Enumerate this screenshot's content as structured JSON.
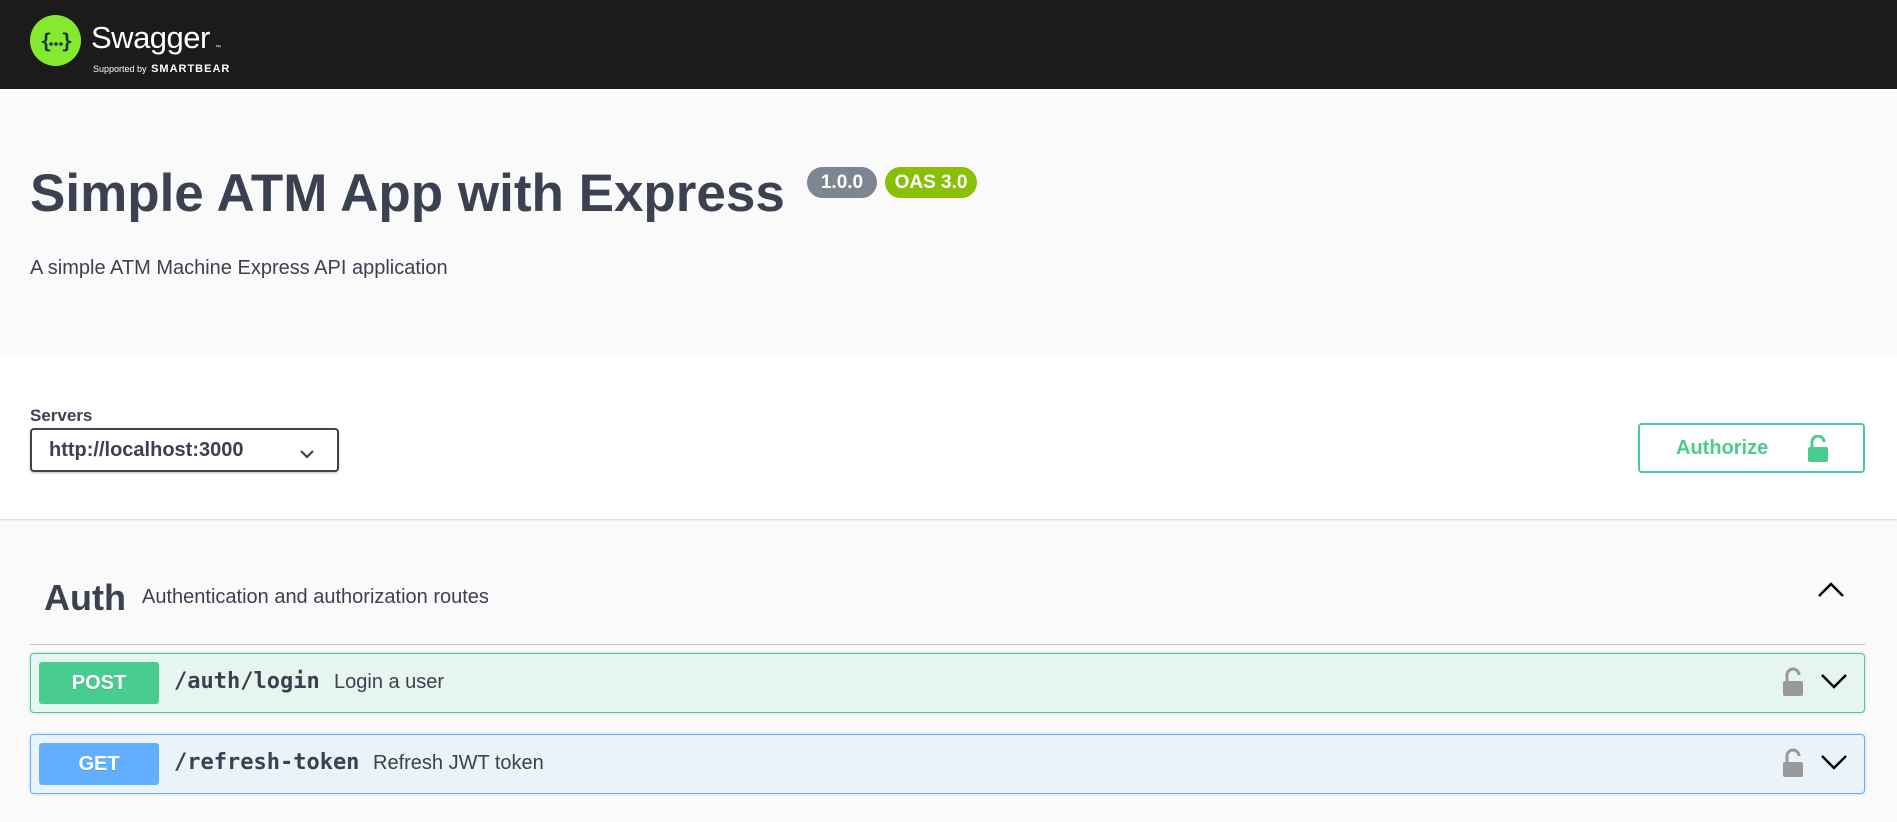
{
  "topbar": {
    "logo_name": "Swagger",
    "logo_tm": "™",
    "logo_sub_prefix": "Supported by",
    "logo_sub_brand": "SMARTBEAR"
  },
  "info": {
    "title": "Simple ATM App with Express",
    "version": "1.0.0",
    "oas": "OAS 3.0",
    "description": "A simple ATM Machine Express API application"
  },
  "servers": {
    "label": "Servers",
    "selected": "http://localhost:3000"
  },
  "authorize": {
    "label": "Authorize"
  },
  "tag": {
    "name": "Auth",
    "description": "Authentication and authorization routes"
  },
  "operations": [
    {
      "method": "POST",
      "path": "/auth/login",
      "summary": "Login a user",
      "color": "#49cc90"
    },
    {
      "method": "GET",
      "path": "/refresh-token",
      "summary": "Refresh JWT token",
      "color": "#61affe"
    }
  ],
  "colors": {
    "topbar": "#1b1b1b",
    "logo": "#85ea2d",
    "text": "#3b4151",
    "post": "#49cc90",
    "get": "#61affe",
    "version_badge": "#7d8492",
    "oas_badge": "#89bf04"
  }
}
